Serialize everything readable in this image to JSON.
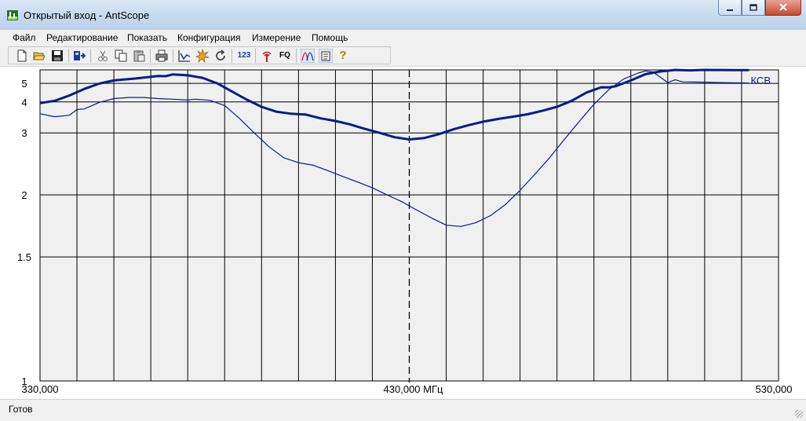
{
  "window": {
    "title": "Открытый вход - AntScope",
    "controls": [
      "minimize",
      "maximize",
      "close"
    ]
  },
  "menu": {
    "items": [
      "Файл",
      "Редактирование",
      "Показать",
      "Конфигурация",
      "Измерение",
      "Помощь"
    ]
  },
  "toolbar": {
    "buttons": [
      {
        "name": "new-file-icon"
      },
      {
        "name": "open-folder-icon"
      },
      {
        "name": "save-icon"
      },
      {
        "name": "export-icon"
      },
      {
        "name": "cut-icon"
      },
      {
        "name": "copy-icon"
      },
      {
        "name": "paste-icon"
      },
      {
        "name": "print-icon"
      },
      {
        "name": "scan-chart-icon"
      },
      {
        "name": "run-icon"
      },
      {
        "name": "refresh-icon"
      },
      {
        "name": "numbers-icon",
        "text": "123"
      },
      {
        "name": "antenna-icon"
      },
      {
        "name": "frequency-icon",
        "text": "FQ"
      },
      {
        "name": "multi-curve-icon"
      },
      {
        "name": "notes-icon"
      },
      {
        "name": "help-icon",
        "text": "?"
      }
    ]
  },
  "chart_data": {
    "type": "line",
    "series_label": "КСВ",
    "x_tick_labels": {
      "left": "330,000",
      "center": "430,000 МГц",
      "right": "530,000"
    },
    "y_tick_labels": [
      "5",
      "4",
      "3",
      "2",
      "1.5",
      "1"
    ],
    "x_range": [
      330,
      530
    ],
    "y_scale": "1/swr",
    "y_range": [
      1,
      6.1
    ],
    "marker_x": 430,
    "grid": true,
    "colors": {
      "series": "#0a1a8c",
      "grid": "#000000",
      "background": "#f0f0f0",
      "marker": "#000000"
    },
    "series": [
      {
        "name": "КСВ",
        "width": "thick",
        "points": [
          [
            330,
            3.95
          ],
          [
            334,
            4.05
          ],
          [
            338,
            4.3
          ],
          [
            342,
            4.65
          ],
          [
            346,
            4.98
          ],
          [
            350,
            5.2
          ],
          [
            356,
            5.35
          ],
          [
            362,
            5.55
          ],
          [
            364,
            5.53
          ],
          [
            366,
            5.68
          ],
          [
            370,
            5.6
          ],
          [
            374,
            5.4
          ],
          [
            378,
            5.0
          ],
          [
            382,
            4.5
          ],
          [
            386,
            4.1
          ],
          [
            390,
            3.8
          ],
          [
            394,
            3.62
          ],
          [
            398,
            3.55
          ],
          [
            402,
            3.52
          ],
          [
            406,
            3.4
          ],
          [
            410,
            3.32
          ],
          [
            414,
            3.22
          ],
          [
            418,
            3.1
          ],
          [
            422,
            3.0
          ],
          [
            426,
            2.9
          ],
          [
            430,
            2.85
          ],
          [
            434,
            2.88
          ],
          [
            438,
            2.97
          ],
          [
            442,
            3.09
          ],
          [
            446,
            3.2
          ],
          [
            450,
            3.3
          ],
          [
            454,
            3.38
          ],
          [
            458,
            3.45
          ],
          [
            462,
            3.53
          ],
          [
            466,
            3.65
          ],
          [
            470,
            3.8
          ],
          [
            474,
            4.05
          ],
          [
            478,
            4.45
          ],
          [
            482,
            4.75
          ],
          [
            484,
            4.74
          ],
          [
            486,
            4.82
          ],
          [
            490,
            5.2
          ],
          [
            494,
            5.7
          ],
          [
            498,
            5.95
          ],
          [
            502,
            6.1
          ],
          [
            506,
            6.05
          ],
          [
            510,
            6.1
          ],
          [
            518,
            6.08
          ],
          [
            522,
            6.08
          ]
        ]
      },
      {
        "name": "",
        "width": "thin",
        "points": [
          [
            330,
            3.55
          ],
          [
            334,
            3.45
          ],
          [
            338,
            3.5
          ],
          [
            340,
            3.7
          ],
          [
            342,
            3.72
          ],
          [
            346,
            3.98
          ],
          [
            350,
            4.15
          ],
          [
            354,
            4.2
          ],
          [
            358,
            4.2
          ],
          [
            362,
            4.15
          ],
          [
            366,
            4.12
          ],
          [
            370,
            4.08
          ],
          [
            372,
            4.12
          ],
          [
            376,
            4.07
          ],
          [
            380,
            3.85
          ],
          [
            384,
            3.4
          ],
          [
            388,
            3.0
          ],
          [
            392,
            2.7
          ],
          [
            396,
            2.5
          ],
          [
            400,
            2.42
          ],
          [
            404,
            2.38
          ],
          [
            408,
            2.3
          ],
          [
            412,
            2.22
          ],
          [
            416,
            2.15
          ],
          [
            420,
            2.08
          ],
          [
            424,
            2.0
          ],
          [
            428,
            1.93
          ],
          [
            432,
            1.85
          ],
          [
            436,
            1.78
          ],
          [
            440,
            1.72
          ],
          [
            444,
            1.71
          ],
          [
            448,
            1.74
          ],
          [
            452,
            1.8
          ],
          [
            456,
            1.9
          ],
          [
            460,
            2.05
          ],
          [
            464,
            2.25
          ],
          [
            468,
            2.5
          ],
          [
            472,
            2.85
          ],
          [
            476,
            3.3
          ],
          [
            480,
            3.9
          ],
          [
            484,
            4.6
          ],
          [
            488,
            5.3
          ],
          [
            492,
            5.8
          ],
          [
            494,
            6.0
          ],
          [
            496,
            5.9
          ],
          [
            498,
            5.45
          ],
          [
            500,
            5.05
          ],
          [
            502,
            5.25
          ],
          [
            504,
            5.1
          ],
          [
            510,
            5.08
          ],
          [
            514,
            5.05
          ],
          [
            522,
            5.02
          ]
        ]
      }
    ]
  },
  "status": {
    "text": "Готов"
  }
}
